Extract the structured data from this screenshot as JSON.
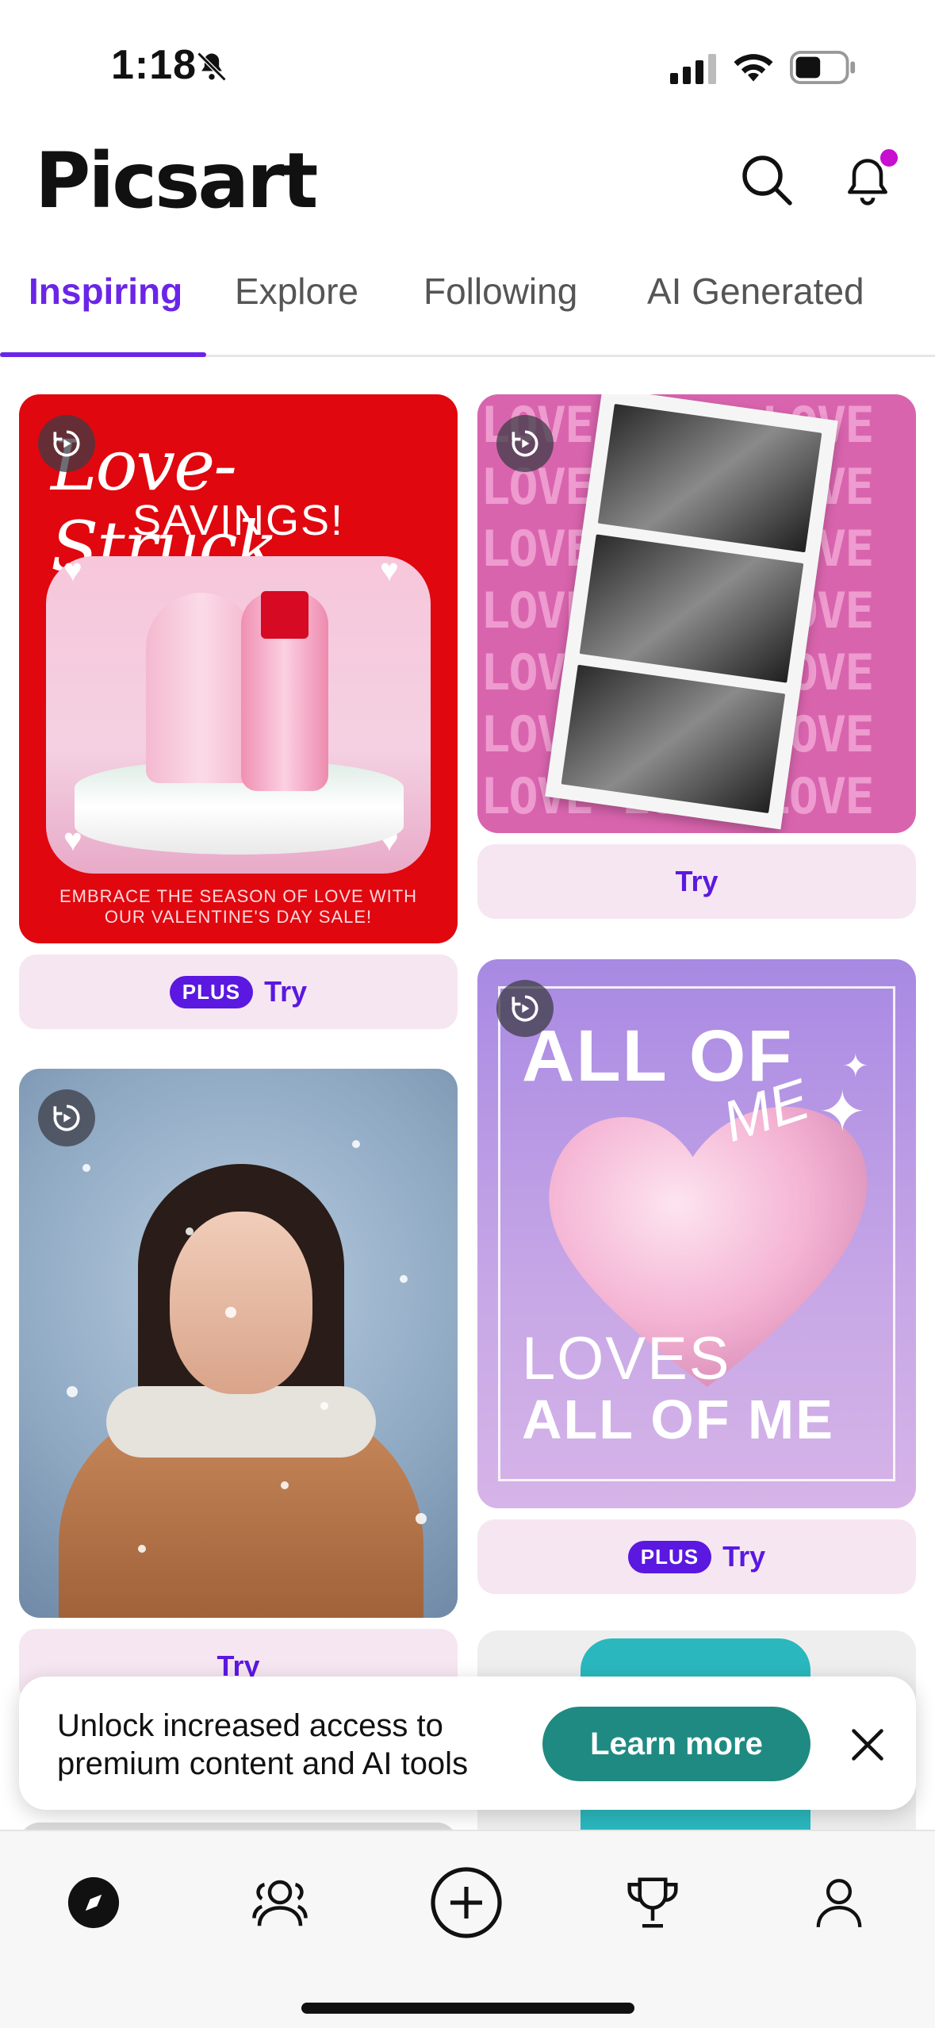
{
  "status_bar": {
    "time": "1:18"
  },
  "header": {
    "logo": "Picsart"
  },
  "tabs": [
    {
      "label": "Inspiring",
      "active": true
    },
    {
      "label": "Explore",
      "active": false
    },
    {
      "label": "Following",
      "active": false
    },
    {
      "label": "AI Generated",
      "active": false
    }
  ],
  "cards": {
    "card1": {
      "script_title": "Love-Struck",
      "subtitle": "SAVINGS!",
      "footer": "EMBRACE THE SEASON OF LOVE WITH OUR VALENTINE'S DAY SALE!",
      "badge": "PLUS",
      "try_label": "Try"
    },
    "card2": {
      "bg_text": "LOVE LOVE LOVE LOVE LOVE LOVE LOVE LOVE LOVE LOVE LOVE LOVE LOVE LOVE LOVE LOVE LOVE LOVE LOVE LOVE LOVE LOVE LOVE LOVE LOVE LOVE LOVE LOVE LOVE LOVE LOVE LOVE",
      "try_label": "Try"
    },
    "card3": {
      "try_label": "Try"
    },
    "card4": {
      "line1": "ALL OF",
      "script": "ME",
      "line2": "LOVES",
      "line3": "ALL OF ME",
      "badge": "PLUS",
      "try_label": "Try"
    }
  },
  "promo": {
    "text": "Unlock increased access to premium content and AI tools",
    "button": "Learn more"
  },
  "bottom_nav": [
    {
      "icon": "compass-icon",
      "active": true
    },
    {
      "icon": "people-icon",
      "active": false
    },
    {
      "icon": "add-circle-icon",
      "active": false
    },
    {
      "icon": "trophy-icon",
      "active": false
    },
    {
      "icon": "profile-icon",
      "active": false
    }
  ],
  "colors": {
    "accent": "#6a25e8",
    "notification_dot": "#c60fcf",
    "try_bar_bg": "#f6e6f1",
    "learn_more_bg": "#1f8a82"
  }
}
